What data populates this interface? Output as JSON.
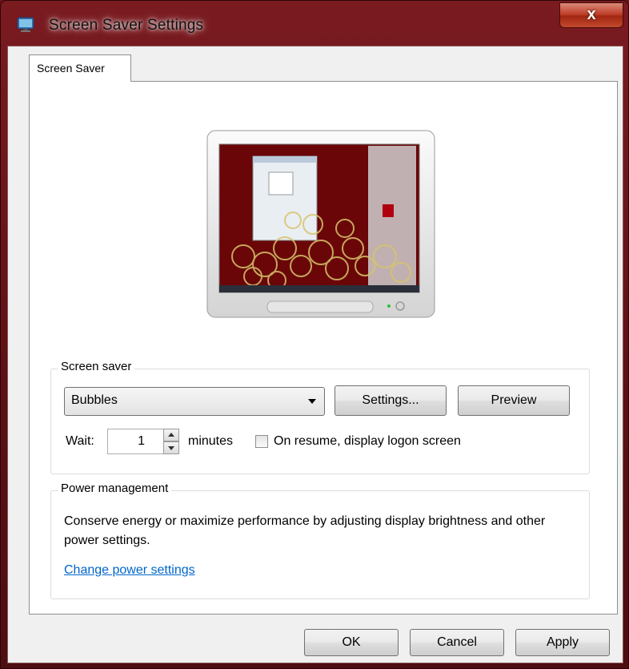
{
  "window": {
    "title": "Screen Saver Settings",
    "close_glyph": "x",
    "icon": "monitor-icon"
  },
  "tabs": [
    {
      "label": "Screen Saver",
      "selected": true
    }
  ],
  "screen_saver": {
    "group_label": "Screen saver",
    "selected": "Bubbles",
    "settings_label": "Settings...",
    "preview_label": "Preview",
    "wait_label": "Wait:",
    "wait_value": "1",
    "minutes_label": "minutes",
    "logon_label": "On resume, display logon screen",
    "logon_checked": false
  },
  "power": {
    "group_label": "Power management",
    "description": "Conserve energy or maximize performance by adjusting display brightness and other power settings.",
    "link_label": "Change power settings"
  },
  "buttons": {
    "ok": "OK",
    "cancel": "Cancel",
    "apply": "Apply"
  },
  "colors": {
    "titlebar": "#6b1418",
    "link": "#0066cc",
    "desktop_bg": "#6a0608"
  }
}
